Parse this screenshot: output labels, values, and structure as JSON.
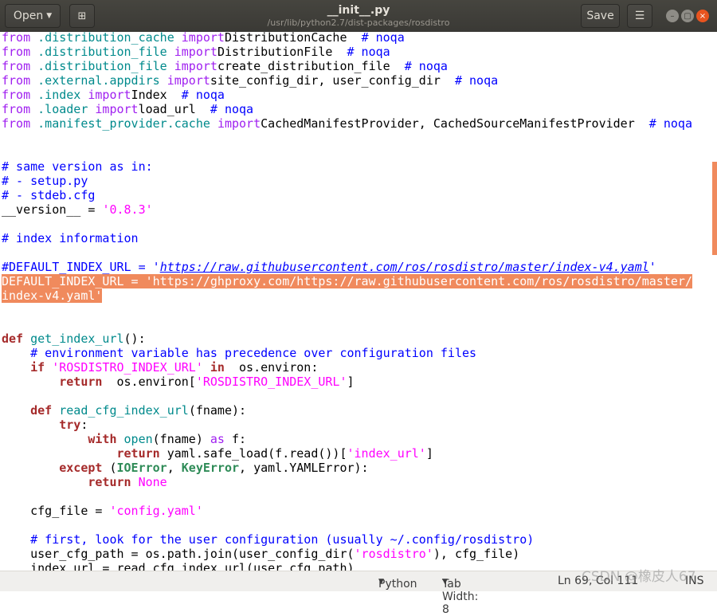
{
  "header": {
    "open_label": "Open",
    "title": "__init__.py",
    "path": "/usr/lib/python2.7/dist-packages/rosdistro",
    "save_label": "Save"
  },
  "code": [
    [
      [
        "k-from",
        "from"
      ],
      [
        "k-id",
        " .distribution_cache "
      ],
      [
        "k-from",
        "import"
      ],
      [
        "",
        "DistributionCache  "
      ],
      [
        "k-cm",
        "# noqa"
      ]
    ],
    [
      [
        "k-from",
        "from"
      ],
      [
        "k-id",
        " .distribution_file "
      ],
      [
        "k-from",
        "import"
      ],
      [
        "",
        "DistributionFile  "
      ],
      [
        "k-cm",
        "# noqa"
      ]
    ],
    [
      [
        "k-from",
        "from"
      ],
      [
        "k-id",
        " .distribution_file "
      ],
      [
        "k-from",
        "import"
      ],
      [
        "",
        "create_distribution_file  "
      ],
      [
        "k-cm",
        "# noqa"
      ]
    ],
    [
      [
        "k-from",
        "from"
      ],
      [
        "k-id",
        " .external.appdirs "
      ],
      [
        "k-from",
        "import"
      ],
      [
        "",
        "site_config_dir, user_config_dir  "
      ],
      [
        "k-cm",
        "# noqa"
      ]
    ],
    [
      [
        "k-from",
        "from"
      ],
      [
        "k-id",
        " .index "
      ],
      [
        "k-from",
        "import"
      ],
      [
        "",
        "Index  "
      ],
      [
        "k-cm",
        "# noqa"
      ]
    ],
    [
      [
        "k-from",
        "from"
      ],
      [
        "k-id",
        " .loader "
      ],
      [
        "k-from",
        "import"
      ],
      [
        "",
        "load_url  "
      ],
      [
        "k-cm",
        "# noqa"
      ]
    ],
    [
      [
        "k-from",
        "from"
      ],
      [
        "k-id",
        " .manifest_provider.cache "
      ],
      [
        "k-from",
        "import"
      ],
      [
        "",
        "CachedManifestProvider, CachedSourceManifestProvider  "
      ],
      [
        "k-cm",
        "# noqa"
      ]
    ],
    [],
    [],
    [
      [
        "k-cm",
        "# same version as in:"
      ]
    ],
    [
      [
        "k-cm",
        "# - setup.py"
      ]
    ],
    [
      [
        "k-cm",
        "# - stdeb.cfg"
      ]
    ],
    [
      [
        "",
        "__version__ = "
      ],
      [
        "k-str",
        "'0.8.3'"
      ]
    ],
    [],
    [
      [
        "k-cm",
        "# index information"
      ]
    ],
    [],
    [
      [
        "k-cm",
        "#DEFAULT_INDEX_URL = '"
      ],
      [
        "k-url",
        "https://raw.githubusercontent.com/ros/rosdistro/master/index-v4.yaml"
      ],
      [
        "k-cm",
        "'"
      ]
    ],
    [
      [
        "",
        "DEFAULT_INDEX_URL = 'https://ghproxy.com/https://raw.githubusercontent.com/ros/rosdistro/master/"
      ]
    ],
    [
      [
        "",
        "index-v4.yaml'"
      ]
    ],
    [],
    [],
    [
      [
        "k-kw",
        "def"
      ],
      [
        "k-id",
        " get_index_url"
      ],
      [
        "",
        "():"
      ]
    ],
    [
      [
        "",
        "    "
      ],
      [
        "k-cm",
        "# environment variable has precedence over configuration files"
      ]
    ],
    [
      [
        "",
        "    "
      ],
      [
        "k-kw",
        "if"
      ],
      [
        "k-str",
        " 'ROSDISTRO_INDEX_URL'"
      ],
      [
        "k-kw",
        " in"
      ],
      [
        "",
        ""
      ],
      [
        "",
        "  os.environ:"
      ]
    ],
    [
      [
        "",
        "        "
      ],
      [
        "k-kw",
        "return"
      ],
      [
        "",
        ""
      ],
      [
        "",
        ""
      ],
      [
        "",
        ""
      ],
      [
        "",
        ""
      ],
      [
        "",
        "  os.environ["
      ],
      [
        "k-str",
        "'ROSDISTRO_INDEX_URL'"
      ],
      [
        "",
        "]"
      ]
    ],
    [],
    [
      [
        "",
        "    "
      ],
      [
        "k-kw",
        "def"
      ],
      [
        "k-id",
        " read_cfg_index_url"
      ],
      [
        "",
        "(fname):"
      ]
    ],
    [
      [
        "",
        "        "
      ],
      [
        "k-kw",
        "try"
      ],
      [
        "",
        ":"
      ]
    ],
    [
      [
        "",
        "            "
      ],
      [
        "k-kw",
        "with"
      ],
      [
        "k-id",
        " open"
      ],
      [
        "",
        "(fname) "
      ],
      [
        "k-from",
        "as"
      ],
      [
        "",
        " f:"
      ]
    ],
    [
      [
        "",
        "                "
      ],
      [
        "k-kw",
        "return"
      ],
      [
        "",
        " yaml.safe_load(f.read())["
      ],
      [
        "k-str",
        "'index_url'"
      ],
      [
        "",
        "]"
      ]
    ],
    [
      [
        "",
        "        "
      ],
      [
        "k-kw",
        "except"
      ],
      [
        "",
        " ("
      ],
      [
        "k-exc",
        "IOError"
      ],
      [
        "",
        ", "
      ],
      [
        "k-exc",
        "KeyError"
      ],
      [
        "",
        ", yaml.YAMLError):"
      ]
    ],
    [
      [
        "",
        "            "
      ],
      [
        "k-kw",
        "return"
      ],
      [
        "k-str",
        " None"
      ]
    ],
    [],
    [
      [
        "",
        "    cfg_file = "
      ],
      [
        "k-str",
        "'config.yaml'"
      ]
    ],
    [],
    [
      [
        "",
        "    "
      ],
      [
        "k-cm",
        "# first, look for the user configuration (usually ~/.config/rosdistro)"
      ]
    ],
    [
      [
        "",
        "    user_cfg_path = os.path.join(user_config_dir("
      ],
      [
        "k-str",
        "'rosdistro'"
      ],
      [
        "",
        "), cfg_file)"
      ]
    ],
    [
      [
        "",
        "    index_url = read_cfg_index_url(user_cfg_path)"
      ]
    ]
  ],
  "highlighted_lines": [
    17,
    18
  ],
  "status": {
    "language": "Python",
    "tab_width": "Tab Width: 8",
    "position": "Ln 69, Col 111",
    "mode": "INS"
  },
  "watermark": "CSDN @橡皮人67"
}
